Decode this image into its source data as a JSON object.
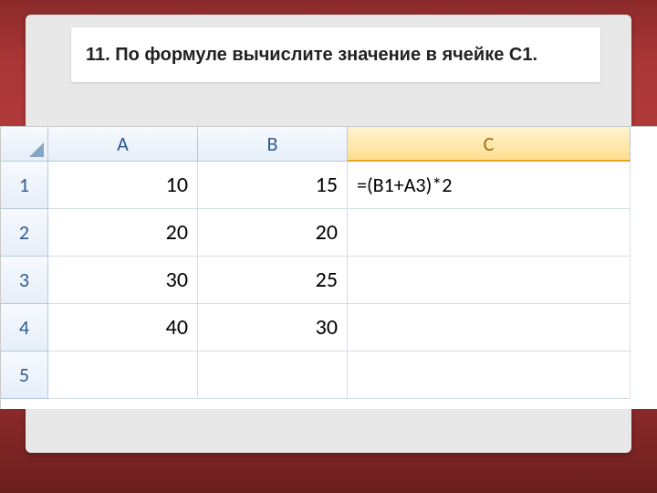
{
  "title": "11. По формуле вычислите значение в ячейке С1.",
  "columns": [
    "A",
    "B",
    "C"
  ],
  "rows": [
    "1",
    "2",
    "3",
    "4",
    "5"
  ],
  "cells": {
    "A1": "10",
    "B1": "15",
    "C1": "=(B1+A3)*2",
    "A2": "20",
    "B2": "20",
    "A3": "30",
    "B3": "25",
    "A4": "40",
    "B4": "30"
  },
  "selected_column": "C"
}
